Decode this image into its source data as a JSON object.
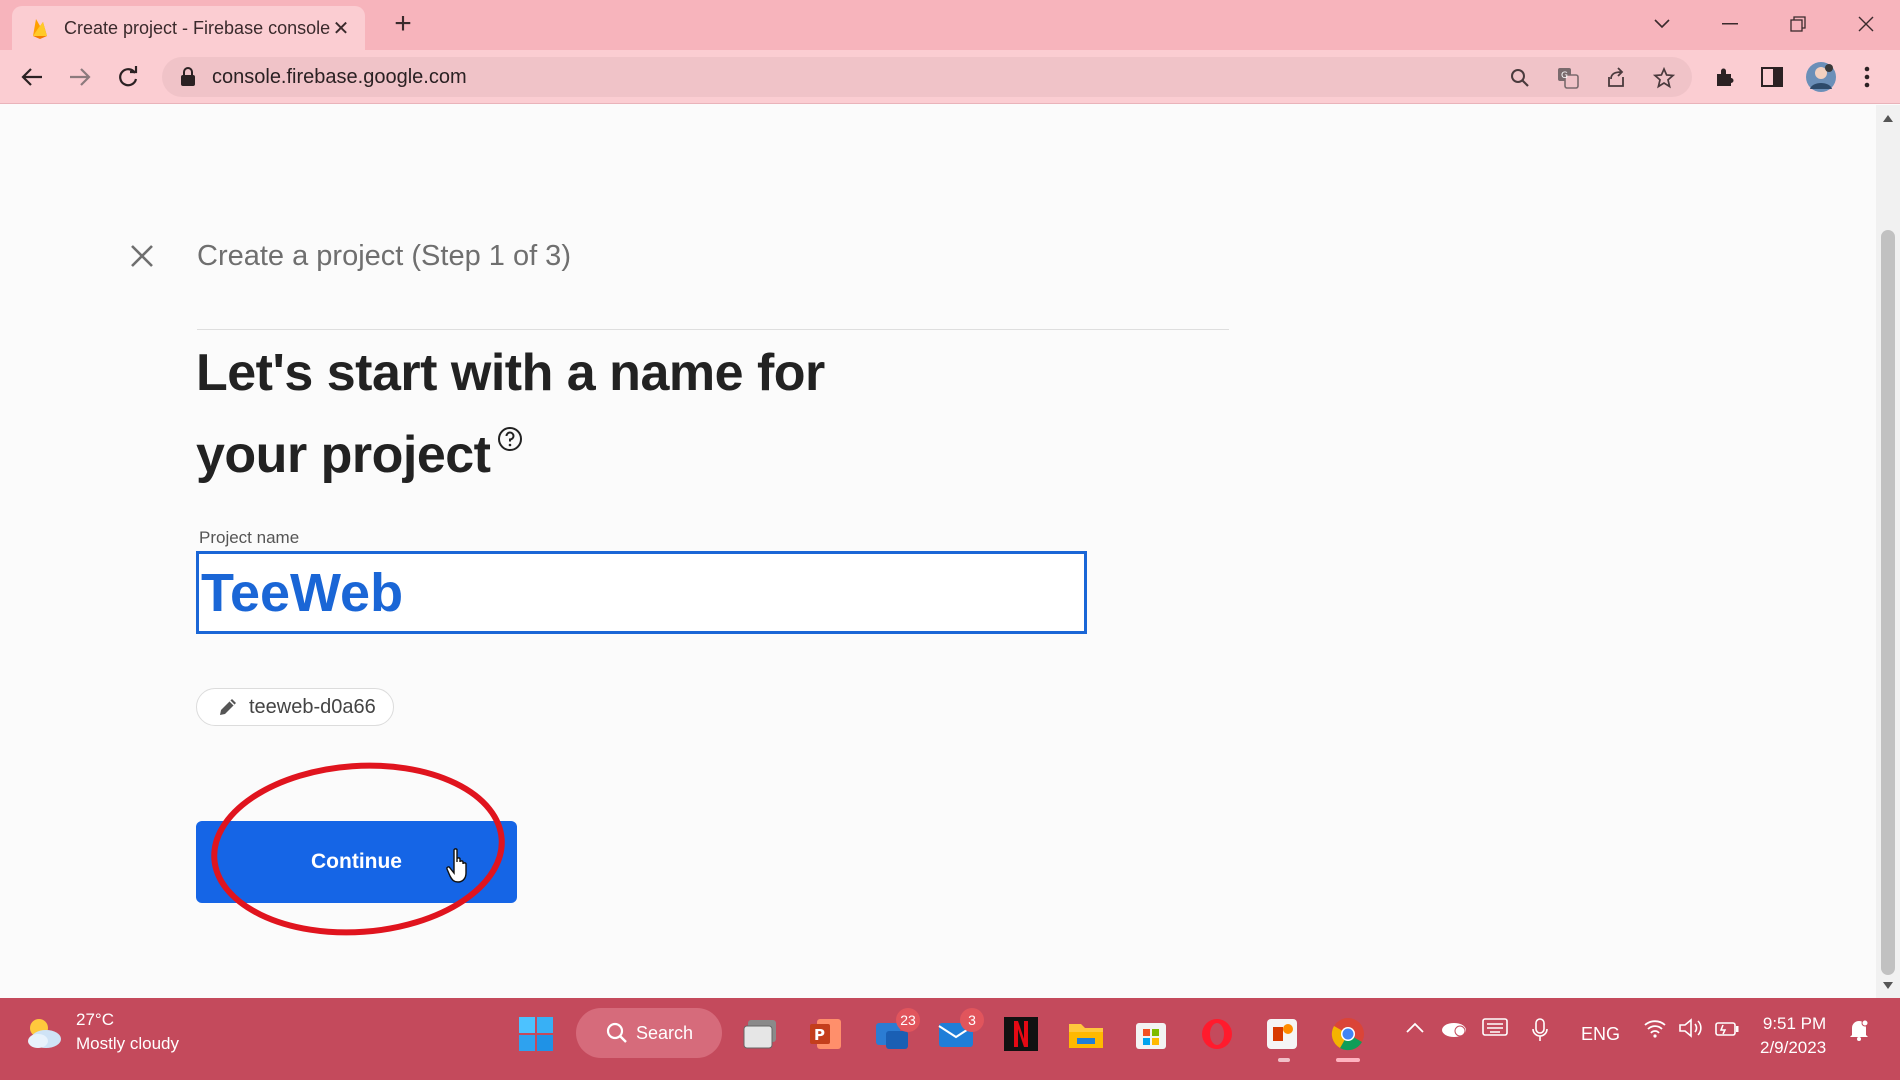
{
  "browser": {
    "tab_title": "Create project - Firebase console",
    "url": "console.firebase.google.com"
  },
  "page": {
    "step_title": "Create a project (Step 1 of 3)",
    "heading_line1": "Let's start with a name for",
    "heading_line2": "your project",
    "field_label": "Project name",
    "field_value": "TeeWeb",
    "project_id": "teeweb-d0a66",
    "continue_label": "Continue"
  },
  "taskbar": {
    "temperature": "27°C",
    "condition": "Mostly cloudy",
    "search_label": "Search",
    "teams_badge": "23",
    "mail_badge": "3",
    "language": "ENG",
    "time": "9:51 PM",
    "date": "2/9/2023"
  },
  "colors": {
    "chrome_tabbar": "#f7b4bc",
    "chrome_toolbar": "#fbcdd2",
    "primary_blue": "#1565e6",
    "annotation_red": "#e0141e",
    "taskbar": "#c44a5c"
  }
}
